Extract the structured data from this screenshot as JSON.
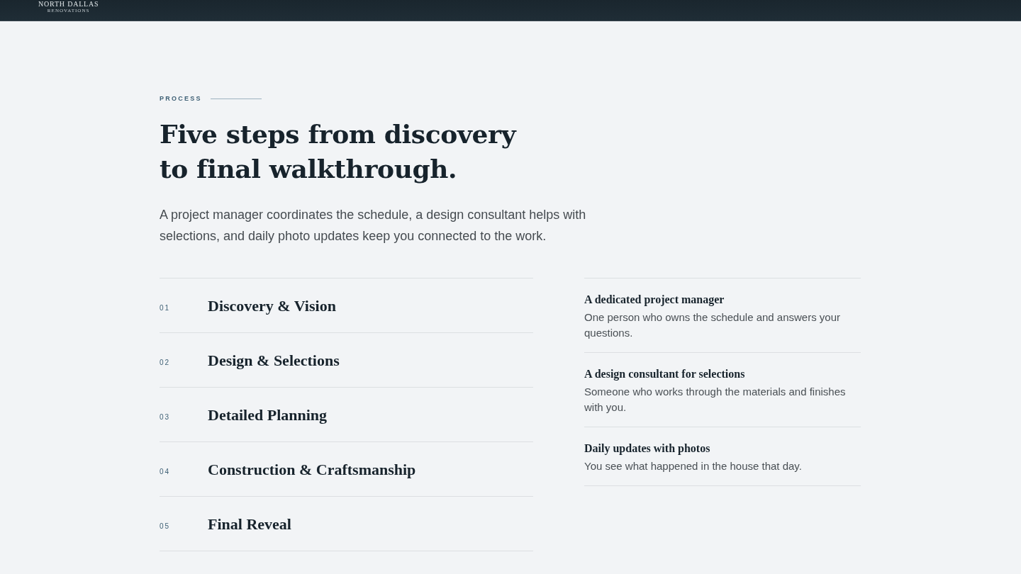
{
  "header": {
    "logo": {
      "name": "NORTH DALLAS",
      "tagline": "RENOVATIONS"
    }
  },
  "section": {
    "eyebrow": "PROCESS",
    "heading": "Five steps from discovery to final walkthrough.",
    "intro": "A project manager coordinates the schedule, a design consultant helps with selections, and daily photo updates keep you connected to the work."
  },
  "steps": [
    {
      "number": "01",
      "title": "Discovery & Vision"
    },
    {
      "number": "02",
      "title": "Design & Selections"
    },
    {
      "number": "03",
      "title": "Detailed Planning"
    },
    {
      "number": "04",
      "title": "Construction & Craftsmanship"
    },
    {
      "number": "05",
      "title": "Final Reveal"
    }
  ],
  "features": [
    {
      "title": "A dedicated project manager",
      "description": "One person who owns the schedule and answers your questions."
    },
    {
      "title": "A design consultant for selections",
      "description": "Someone who works through the materials and finishes with you."
    },
    {
      "title": "Daily updates with photos",
      "description": "You see what happened in the house that day."
    }
  ]
}
